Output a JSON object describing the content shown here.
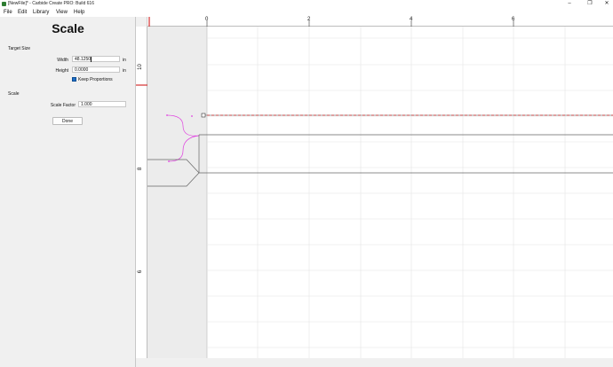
{
  "window": {
    "title": "[NewFile]* - Carbide Create PRO: Build 616",
    "minimize_glyph": "–",
    "maximize_glyph": "❐",
    "close_glyph": "✕"
  },
  "menu": {
    "items": [
      {
        "label": "File"
      },
      {
        "label": "Edit"
      },
      {
        "label": "Library"
      },
      {
        "label": "View"
      },
      {
        "label": "Help"
      }
    ]
  },
  "panel": {
    "title": "Scale",
    "target_size": {
      "heading": "Target Size",
      "width_label": "Width",
      "width_value": "48.1250",
      "height_label": "Height",
      "height_value": "0.0000",
      "unit": "in",
      "keep_proportions_label": "Keep Proportions",
      "keep_proportions_checked": true
    },
    "scale": {
      "heading": "Scale",
      "factor_label": "Scale Factor",
      "factor_value": "1.000"
    },
    "done_label": "Done"
  },
  "rulers": {
    "top_labels": [
      "0",
      "2",
      "4",
      "6"
    ],
    "left_labels": [
      "10",
      "8",
      "6"
    ]
  },
  "colors": {
    "accent_red": "#d32f2f",
    "magenta_path": "#e040e0",
    "checkbox_blue": "#1e6fc7",
    "grid_line": "#e4e4e4",
    "shape_stroke": "#555555"
  }
}
